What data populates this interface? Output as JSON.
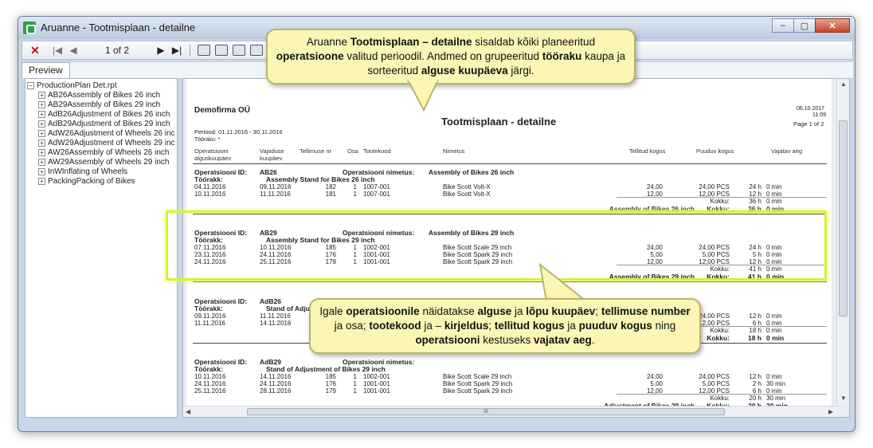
{
  "window": {
    "title": "Aruanne - Tootmisplaan - detailne",
    "minimize_label": "–",
    "maximize_label": "▢",
    "close_label": "✕"
  },
  "toolbar": {
    "close_symbol": "✕",
    "first_symbol": "|◀",
    "prev_symbol": "◀",
    "page_indicator": "1 of 2",
    "next_symbol": "▶",
    "last_symbol": "▶|"
  },
  "tabs": [
    {
      "label": "Preview"
    }
  ],
  "tree": {
    "root": "ProductionPlan Det.rpt",
    "items": [
      "AB26Assembly of Bikes 26 inch",
      "AB29Assembly of Bikes 29 inch",
      "AdB26Adjustment of Bikes 26 inch",
      "AdB29Adjustment of Bikes 29 inch",
      "AdW26Adjustment of Wheels 26 inch",
      "AdW29Adjustment of Wheels 29 inch",
      "AW26Assembly of Wheels 26 inch",
      "AW29Assembly of Wheels 29 inch",
      "InWInflating of Wheels",
      "PackingPacking of Bikes"
    ]
  },
  "report": {
    "company": "Demofirma OÜ",
    "title": "Tootmisplaan - detailne",
    "date": "06.10.2017",
    "time": "11:09",
    "page": "Page 1 of 2",
    "period": "Periood: 01.11.2016 - 30.11.2016",
    "workcenter_filter": "Tööraku: *",
    "columns": {
      "op_start_1": "Operatsiooni",
      "op_start_2": "alguskuupäev",
      "due_1": "Vajaduse",
      "due_2": "kuupäev",
      "order_no": "Tellimuse nr",
      "part": "Osa",
      "item_code": "Tootekood",
      "name": "Nimetus",
      "ordered_qty": "Tellitud kogus",
      "shortage_qty": "Puuduv kogus",
      "time_needed": "Vajatav aeg"
    },
    "labels": {
      "op_id": "Operatsiooni ID:",
      "op_name": "Operatsiooni nimetus:",
      "workcenter": "Töörakk:",
      "total": "Kokku:"
    },
    "groups": [
      {
        "id": "AB26",
        "name": "Assembly of Bikes 26 inch",
        "workcenter": "Assembly Stand for Bikes 26 inch",
        "rows": [
          [
            "04.11.2016",
            "09.11.2016",
            "182",
            "1",
            "1007-001",
            "Bike Scott Volt-X",
            "24,00",
            "24,00 PCS",
            "24 h",
            "0 min"
          ],
          [
            "10.11.2016",
            "11.11.2016",
            "181",
            "1",
            "1007-001",
            "Bike Scott Volt-X",
            "12,00",
            "12,00 PCS",
            "12 h",
            "0 min"
          ]
        ],
        "subtotal": [
          "Kokku:",
          "36 h",
          "0 min"
        ],
        "total_label": "Assembly of Bikes 26 inch",
        "total": [
          "Kokku:",
          "36 h",
          "0 min"
        ]
      },
      {
        "id": "AB29",
        "name": "Assembly of Bikes 29 inch",
        "workcenter": "Assembly Stand for Bikes 29 inch",
        "rows": [
          [
            "07.11.2016",
            "10.11.2016",
            "185",
            "1",
            "1002-001",
            "Bike Scott Scale 29 inch",
            "24,00",
            "24,00 PCS",
            "24 h",
            "0 min"
          ],
          [
            "23.11.2016",
            "24.11.2016",
            "176",
            "1",
            "1001-001",
            "Bike Scott Spark 29 inch",
            "5,00",
            "5,00 PCS",
            "5 h",
            "0 min"
          ],
          [
            "24.11.2016",
            "25.11.2016",
            "179",
            "1",
            "1001-001",
            "Bike Scott Spark 29 inch",
            "12,00",
            "12,00 PCS",
            "12 h",
            "0 min"
          ]
        ],
        "subtotal": [
          "Kokku:",
          "41 h",
          "0 min"
        ],
        "total_label": "Assembly of Bikes 29 inch",
        "total": [
          "Kokku:",
          "41 h",
          "0 min"
        ]
      },
      {
        "id": "AdB26",
        "name": "Adjustment of Bikes 26 inch",
        "workcenter": "Stand of Adjust",
        "rows": [
          [
            "09.11.2016",
            "11.11.2016",
            "",
            "",
            "",
            "",
            "",
            "24,00 PCS",
            "12 h",
            "0 min"
          ],
          [
            "11.11.2016",
            "14.11.2016",
            "",
            "",
            "",
            "",
            "",
            "12,00 PCS",
            "6 h",
            "0 min"
          ]
        ],
        "subtotal": [
          "Kokku:",
          "18 h",
          "0 min"
        ],
        "total": [
          "Kokku:",
          "18 h",
          "0 min"
        ]
      },
      {
        "id": "AdB29",
        "name": "",
        "workcenter": "Stand of Adjustment of Bikes 29 inch",
        "rows": [
          [
            "10.11.2016",
            "14.11.2016",
            "185",
            "1",
            "1002-001",
            "Bike Scott Scale 29 inch",
            "24,00",
            "24,00 PCS",
            "12 h",
            "0 min"
          ],
          [
            "24.11.2016",
            "24.11.2016",
            "176",
            "1",
            "1001-001",
            "Bike Scott Spark 29 inch",
            "5,00",
            "5,00 PCS",
            "2 h",
            "30 min"
          ],
          [
            "25.11.2016",
            "28.11.2016",
            "179",
            "1",
            "1001-001",
            "Bike Scott Spark 29 inch",
            "12,00",
            "12,00 PCS",
            "6 h",
            "0 min"
          ]
        ],
        "subtotal": [
          "Kokku:",
          "20 h",
          "30 min"
        ],
        "total_label": "Adjustment of Bikes 29 inch",
        "total": [
          "Kokku:",
          "20 h",
          "30 min"
        ]
      }
    ],
    "hscroll_label": "III"
  },
  "callouts": {
    "top": {
      "p1": "Aruanne ",
      "b1": "Tootmisplaan – detailne",
      "p2": " sisaldab kõiki planeeritud ",
      "b2": "operatsioone",
      "p3": " valitud perioodil. Andmed on grupeeritud ",
      "b3": "tööraku",
      "p4": " kaupa ja sorteeritud ",
      "b4": "alguse kuupäeva",
      "p5": " järgi."
    },
    "bottom": {
      "p1": "Igale ",
      "b1": "operatsioonile",
      "p2": " näidatakse ",
      "b2": "alguse",
      "p3": " ja ",
      "b3": "lõpu kuupäev",
      "p4": "; ",
      "b4": "tellimuse number",
      "p5": " ja osa; ",
      "b5": "tootekood",
      "p6": " ja – ",
      "b6": "kirjeldus",
      "p7": "; ",
      "b7": "tellitud kogus",
      "p8": " ja ",
      "b8": "puuduv kogus",
      "p9": " ning ",
      "b9": "operatsiooni",
      "p10": " kestuseks ",
      "b10": "vajatav aeg",
      "p11": "."
    }
  }
}
